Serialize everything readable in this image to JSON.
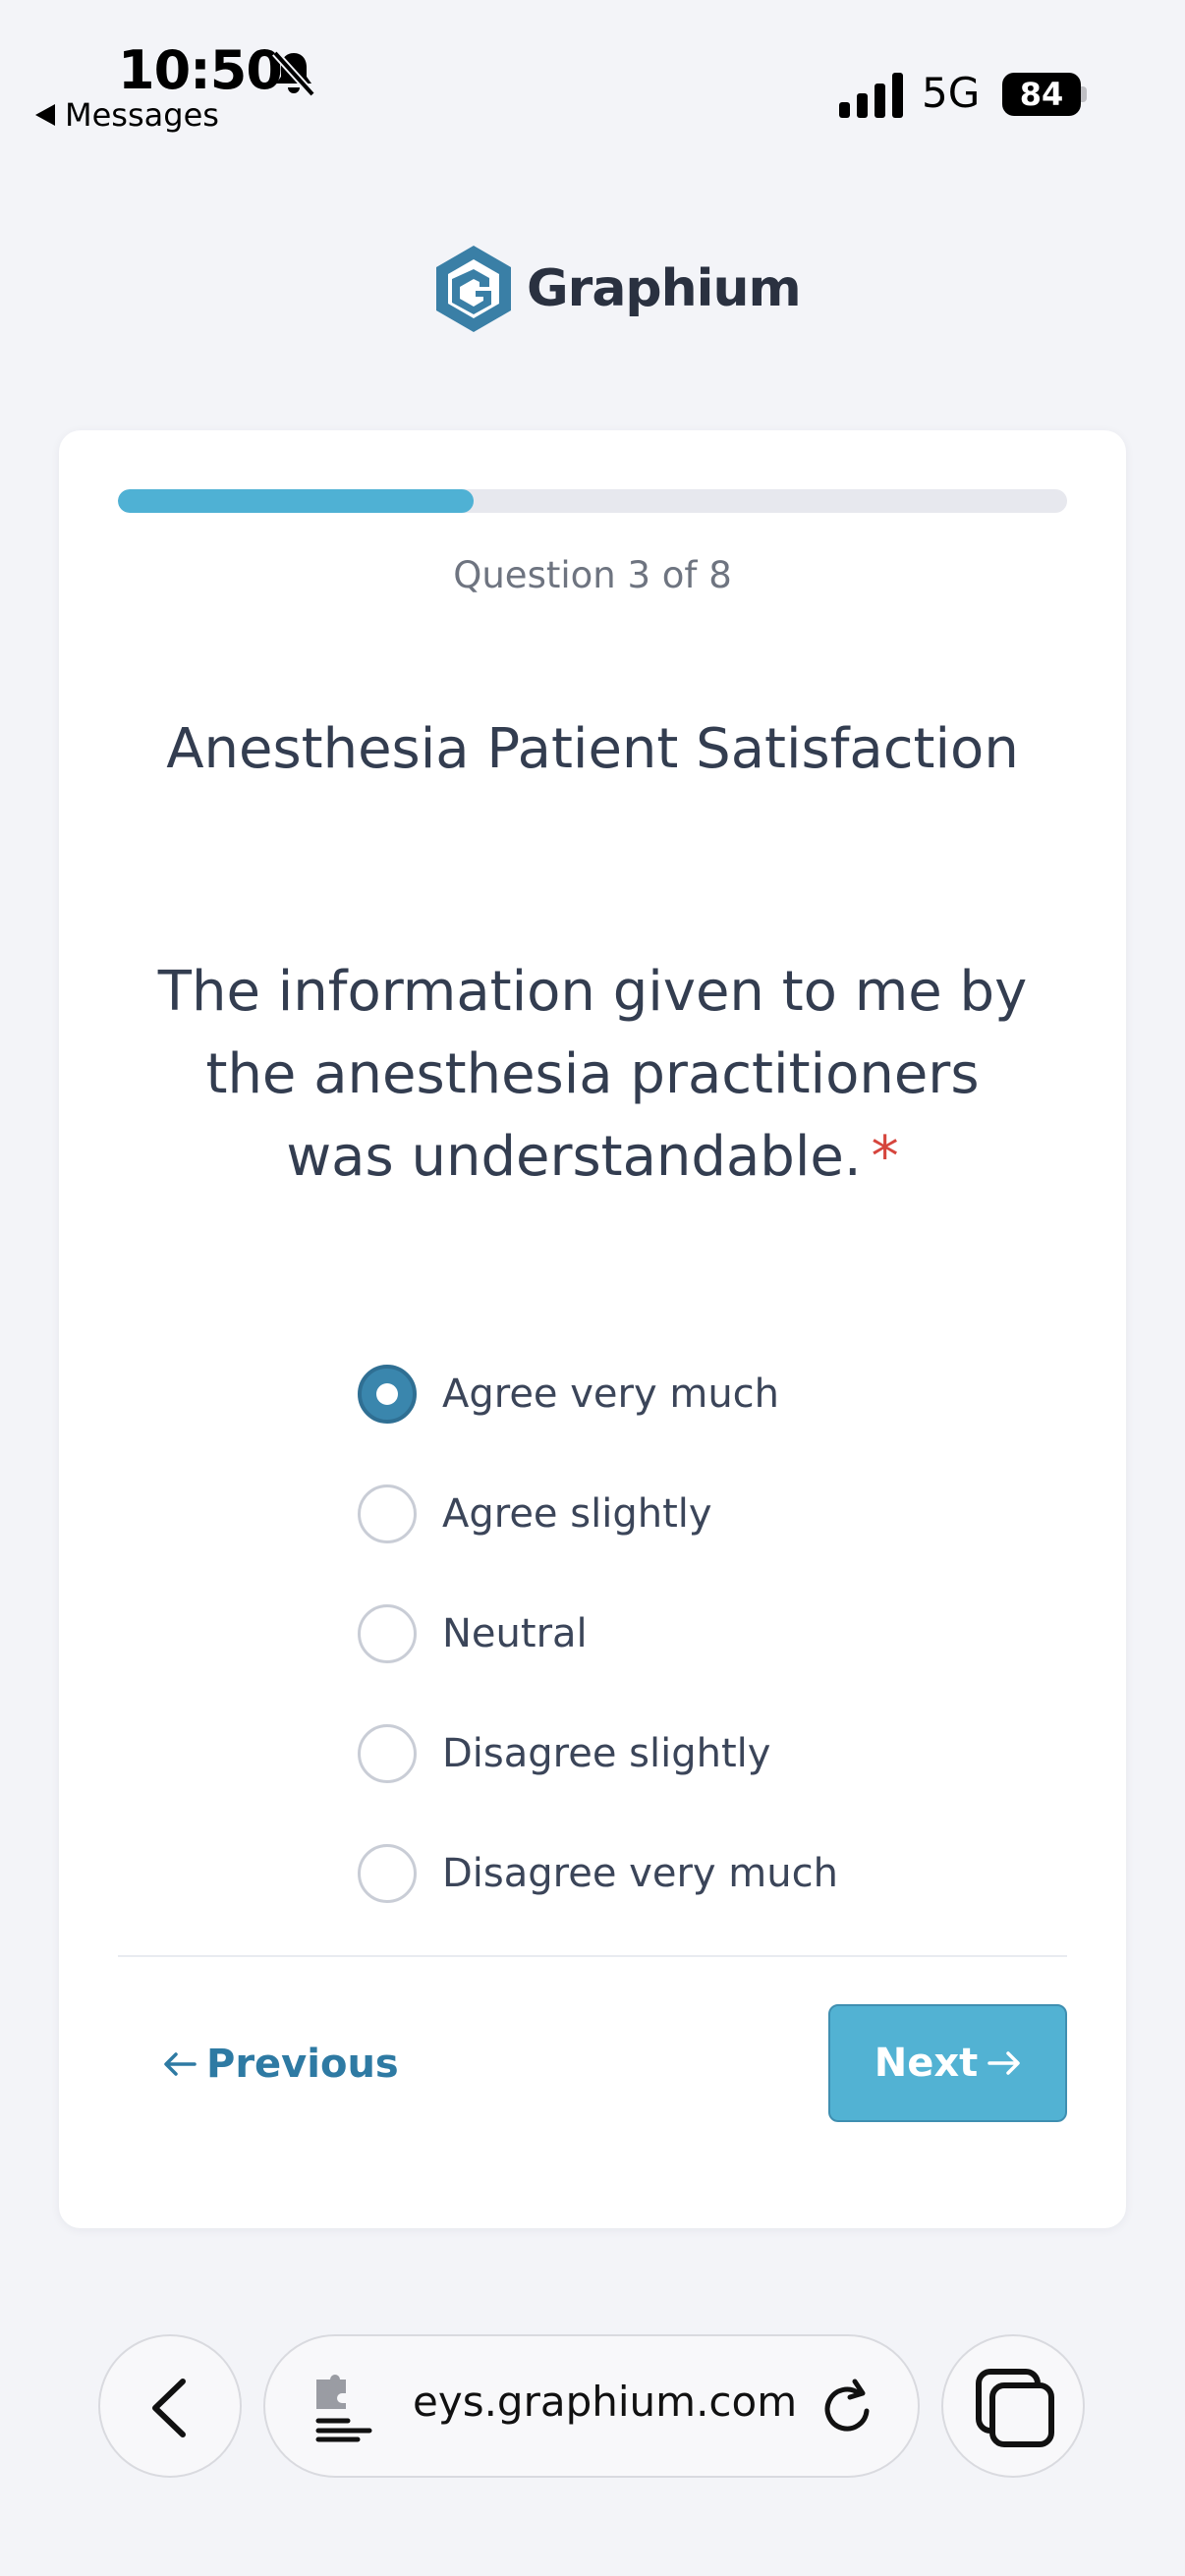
{
  "status_bar": {
    "time": "10:50",
    "back_label": "Messages",
    "network": "5G",
    "battery": "84"
  },
  "brand": {
    "name": "Graphium",
    "accent_color": "#4fb1d4",
    "logo_color": "#3a7fa6"
  },
  "survey": {
    "progress": {
      "current": 3,
      "total": 8,
      "fraction": 0.375,
      "label": "Question 3 of 8"
    },
    "title": "Anesthesia Patient Satisfaction",
    "question": "The information given to me by the anesthesia practitioners was understandable.",
    "required_marker": "*",
    "options": [
      {
        "label": "Agree very much",
        "selected": true
      },
      {
        "label": "Agree slightly",
        "selected": false
      },
      {
        "label": "Neutral",
        "selected": false
      },
      {
        "label": "Disagree slightly",
        "selected": false
      },
      {
        "label": "Disagree very much",
        "selected": false
      }
    ],
    "nav": {
      "previous_label": "Previous",
      "next_label": "Next"
    }
  },
  "browser": {
    "url_display": "eys.graphium.com"
  }
}
